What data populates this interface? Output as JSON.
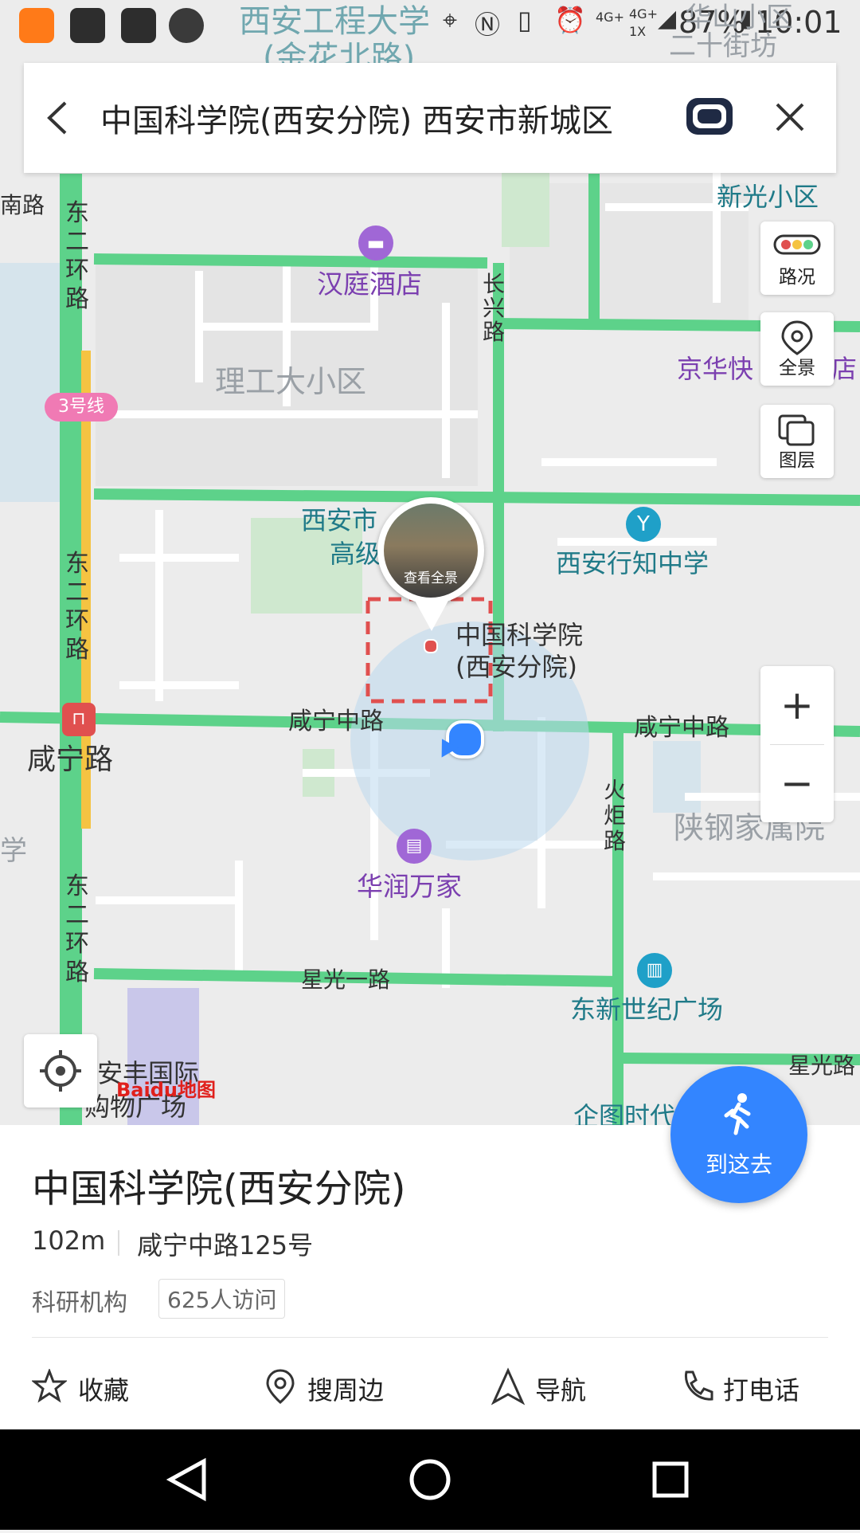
{
  "status_bar": {
    "battery": "87%",
    "time": "10:01",
    "net1": "4G+",
    "net2": "4G+",
    "net3": "1X"
  },
  "search": {
    "query": "中国科学院(西安分院) 西安市新城区"
  },
  "map_controls": {
    "traffic": "路况",
    "panorama": "全景",
    "layers": "图层",
    "zoom_in": "+",
    "zoom_out": "−"
  },
  "map_labels": {
    "top_university": "西安工程大学",
    "top_road": "(金花北路)",
    "top_right1": "华山小区",
    "top_right2": "二十街坊",
    "xinguang": "新光小区",
    "nanlu": "南路",
    "hanting": "汉庭酒店",
    "changxing": "长兴路",
    "ligong": "理工大小区",
    "jinghua": "京华快",
    "jinghua_end": "店",
    "line3": "3号线",
    "donger_top": "东二环路",
    "donger_mid": "东二环路",
    "donger_bottom": "东二环路",
    "xian_school1": "西安市",
    "xian_school2": "高级",
    "panorama_btn": "查看全景",
    "poi_name1": "中国科学院",
    "poi_name2": "(西安分院)",
    "xingzhi": "西安行知中学",
    "xianning_left": "咸宁中路",
    "xianning_right": "咸宁中路",
    "xianning_station": "咸宁路",
    "huoju": "火炬路",
    "shangang": "陕钢家属院",
    "xue": "学",
    "huarun": "华润万家",
    "xingguang1": "星光一路",
    "dongxin": "东新世纪广场",
    "xingguang_right": "星光路",
    "anfeng1": "安丰国际",
    "anfeng2": "购物广场",
    "baidu": "Baidu地图",
    "qitu": "企图时代"
  },
  "card": {
    "title": "中国科学院(西安分院)",
    "distance": "102m",
    "address": "咸宁中路125号",
    "category": "科研机构",
    "visits": "625人访问",
    "go_here": "到这去",
    "actions": [
      {
        "label": "收藏",
        "icon": "star-icon"
      },
      {
        "label": "搜周边",
        "icon": "location-pin-icon"
      },
      {
        "label": "导航",
        "icon": "navigation-arrow-icon"
      },
      {
        "label": "打电话",
        "icon": "phone-icon"
      }
    ]
  },
  "colors": {
    "road_green": "#5dd28a",
    "metro_yellow": "#f5c342",
    "accent_blue": "#3385ff",
    "poi_purple": "#a067d6",
    "poi_teal": "#1fa0c8"
  }
}
